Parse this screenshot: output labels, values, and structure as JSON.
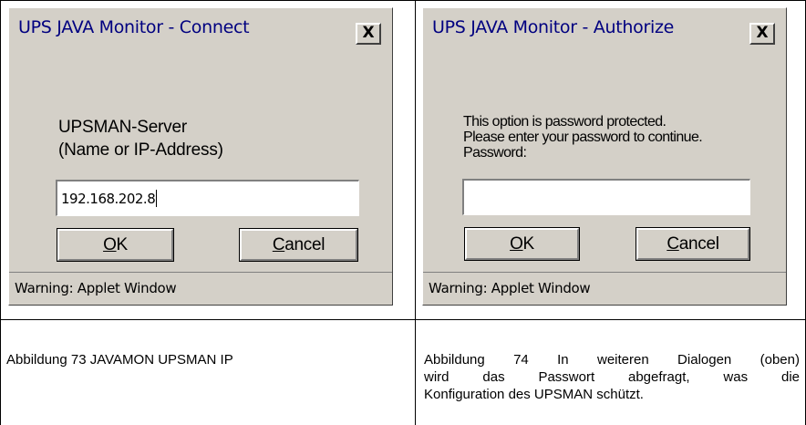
{
  "connect_dialog": {
    "title": "UPS JAVA Monitor - Connect",
    "close_label": "X",
    "server_label_line1": "UPSMAN-Server",
    "server_label_line2": "(Name or IP-Address)",
    "server_value": "192.168.202.8",
    "ok_label": "OK",
    "cancel_label": "Cancel",
    "status_text": "Warning: Applet Window"
  },
  "authorize_dialog": {
    "title": "UPS JAVA Monitor - Authorize",
    "close_label": "X",
    "message_line1": "This option is password protected.",
    "message_line2": "Please enter your password to continue.",
    "password_label": "Password:",
    "password_value": "",
    "ok_label": "OK",
    "cancel_label": "Cancel",
    "status_text": "Warning: Applet Window"
  },
  "captions": {
    "left": "Abbildung 73 JAVAMON UPSMAN IP",
    "right_line1": "Abbildung 74 In weiteren Dialogen (oben)",
    "right_line2": "wird das Passwort abgefragt, was die",
    "right_line3": "Konfiguration des UPSMAN schützt."
  }
}
